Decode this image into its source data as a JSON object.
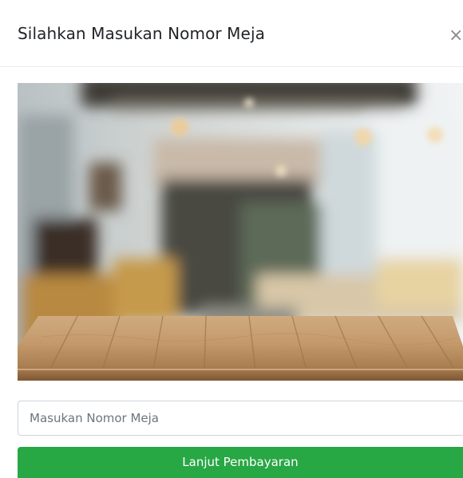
{
  "modal": {
    "title": "Silahkan Masukan Nomor Meja",
    "close_label": "×"
  },
  "form": {
    "table_number_placeholder": "Masukan Nomor Meja",
    "table_number_value": "",
    "submit_label": "Lanjut Pembayaran"
  },
  "theme": {
    "primary_green": "#28a745",
    "border_color": "#ced4da"
  }
}
